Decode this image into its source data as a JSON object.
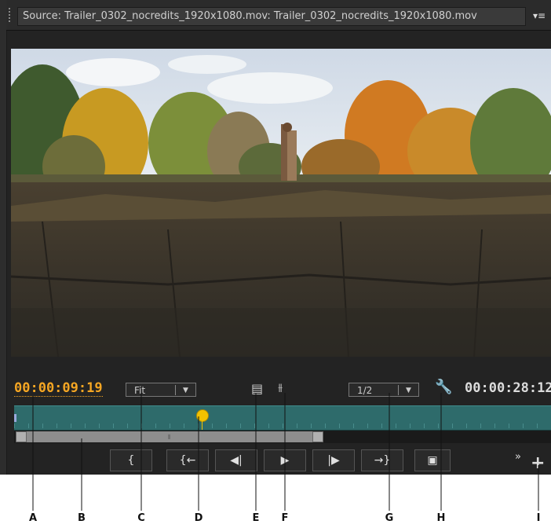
{
  "window": {
    "title": "Source: Trailer_0302_nocredits_1920x1080.mov: Trailer_0302_nocredits_1920x1080.mov"
  },
  "timecode": {
    "current": "00:00:09:19",
    "duration": "00:00:28:12"
  },
  "zoom_dropdown": {
    "value": "Fit"
  },
  "resolution_dropdown": {
    "value": "1/2"
  },
  "buttons": {
    "mark_in": "{",
    "go_to_in": "{←",
    "step_back": "◀|",
    "play": "▶",
    "step_forward": "|▶",
    "go_to_out": "→}",
    "export_frame": "▣"
  },
  "icons": {
    "panel_menu": "hamburger-icon",
    "drag_video": "filmstrip-icon",
    "drag_audio": "waveform-icon",
    "settings": "wrench-icon",
    "more": "double-chevron-icon",
    "add": "plus-icon"
  },
  "callouts": [
    "A",
    "B",
    "C",
    "D",
    "E",
    "F",
    "G",
    "H",
    "I"
  ],
  "colors": {
    "timecode_accent": "#f5a623",
    "timeline": "#2e6b6b",
    "playhead": "#f2c200"
  }
}
